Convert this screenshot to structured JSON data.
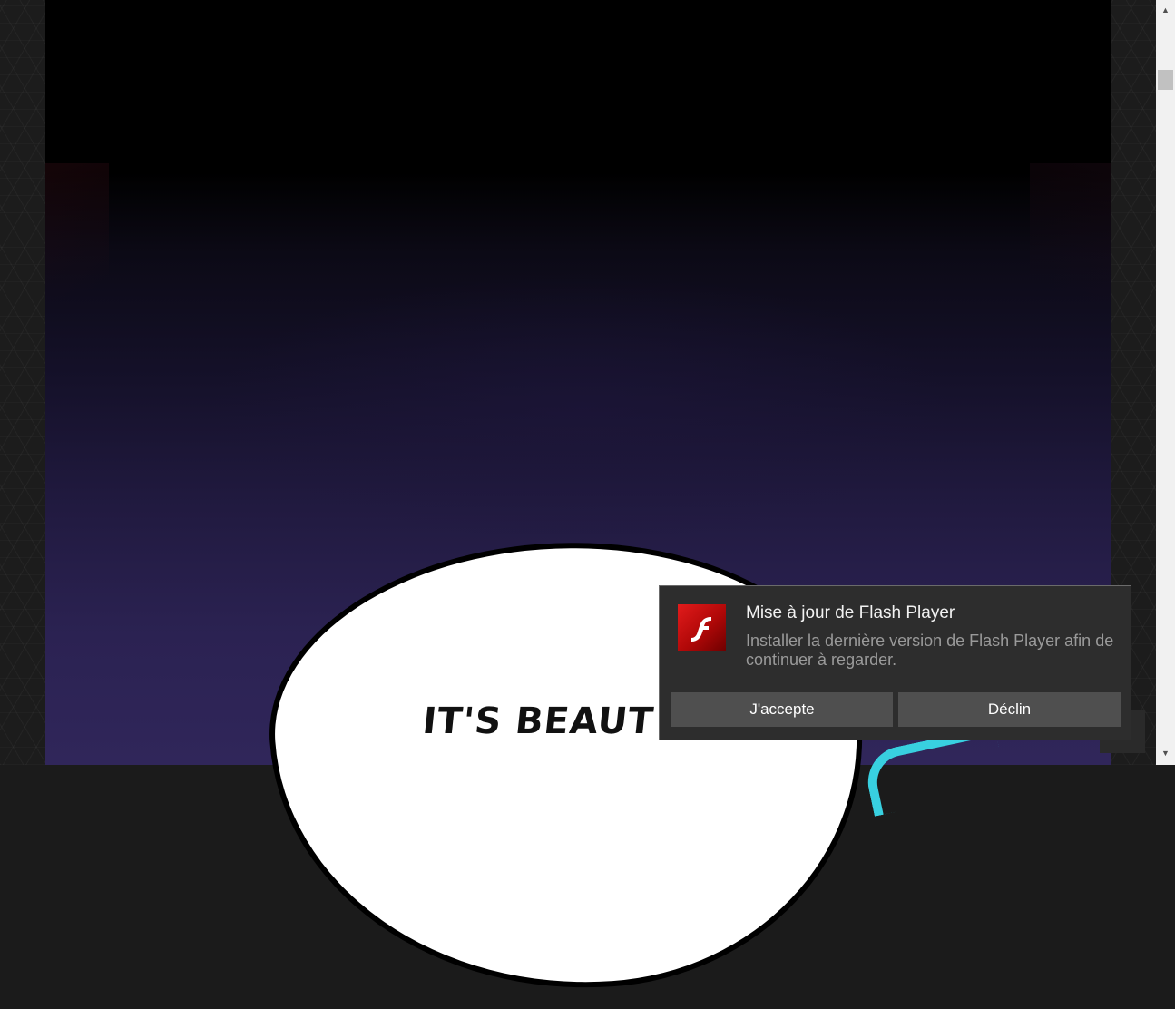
{
  "comic": {
    "bubble_text": "IT'S BEAUT"
  },
  "notification": {
    "icon": "flash-player-icon",
    "title": "Mise à jour de Flash Player",
    "body": "Installer la dernière version de Flash Player afin de continuer à regarder.",
    "accept_label": "J'accepte",
    "decline_label": "Déclin"
  },
  "scrollbar": {
    "up_arrow": "▲",
    "down_arrow": "▼"
  },
  "colors": {
    "notification_bg": "#2d2d2d",
    "button_bg": "#4f4f4f",
    "flash_red": "#e21b1b"
  }
}
